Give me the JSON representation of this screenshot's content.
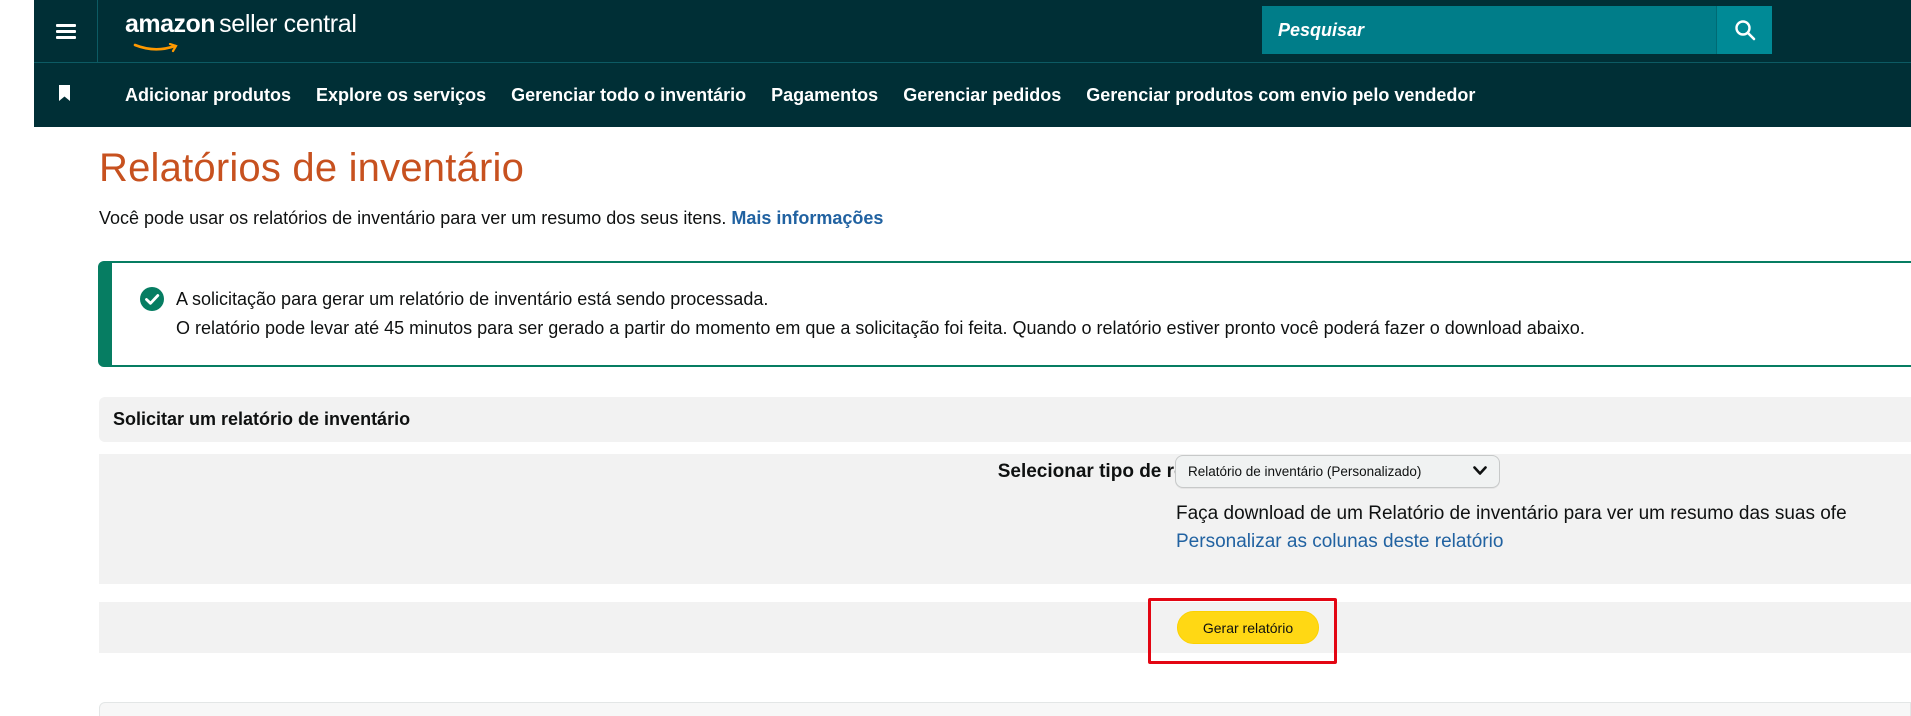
{
  "header": {
    "logo_main": "amazon",
    "logo_rest": "seller central",
    "search_placeholder": "Pesquisar"
  },
  "nav": {
    "items": [
      "Adicionar produtos",
      "Explore os serviços",
      "Gerenciar todo o inventário",
      "Pagamentos",
      "Gerenciar pedidos",
      "Gerenciar produtos com envio pelo vendedor"
    ]
  },
  "page": {
    "title": "Relatórios de inventário",
    "subtitle": "Você pode usar os relatórios de inventário para ver um resumo dos seus itens.",
    "subtitle_link": "Mais informações"
  },
  "alert": {
    "line1": "A solicitação para gerar um relatório de inventário está sendo processada.",
    "line2": "O relatório pode levar até 45 minutos para ser gerado a partir do momento em que a solicitação foi feita. Quando o relatório estiver pronto você poderá fazer o download abaixo."
  },
  "request_section": {
    "header": "Solicitar um relatório de inventário",
    "select_label": "Selecionar tipo de relatório:",
    "select_value": "Relatório de inventário (Personalizado)",
    "description": "Faça download de um Relatório de inventário para ver um resumo das suas ofe",
    "customize_link": "Personalizar as colunas deste relatório",
    "generate_button": "Gerar relatório"
  },
  "colors": {
    "header_bg": "#002f36",
    "search_bg": "#007d89",
    "title_orange": "#c7511f",
    "link_blue": "#2162a1",
    "success_green": "#067d62",
    "button_yellow": "#ffd814",
    "highlight_red": "#e30613"
  }
}
